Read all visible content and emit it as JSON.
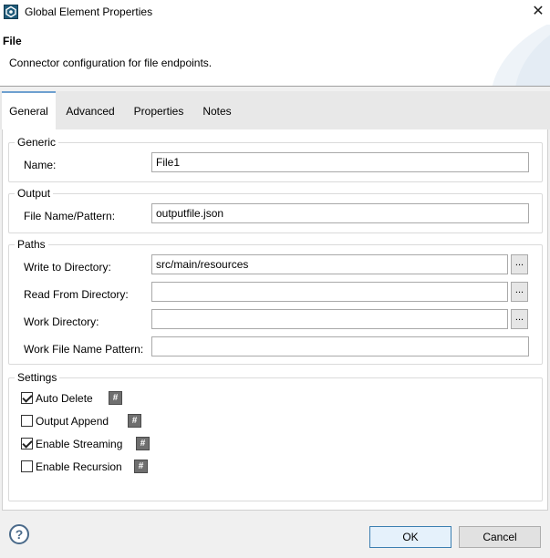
{
  "window": {
    "title": "Global Element Properties",
    "icon": "mule-config-icon",
    "close_glyph": "✕"
  },
  "header": {
    "title": "File",
    "description": "Connector configuration for file endpoints."
  },
  "tabs": [
    {
      "label": "General",
      "active": true
    },
    {
      "label": "Advanced",
      "active": false
    },
    {
      "label": "Properties",
      "active": false
    },
    {
      "label": "Notes",
      "active": false
    }
  ],
  "generic": {
    "title": "Generic",
    "name_label": "Name:",
    "name_value": "File1"
  },
  "output": {
    "title": "Output",
    "pattern_label": "File Name/Pattern:",
    "pattern_value": "outputfile.json"
  },
  "paths": {
    "title": "Paths",
    "write_label": "Write to Directory:",
    "write_value": "src/main/resources",
    "read_label": "Read From Directory:",
    "read_value": "",
    "work_label": "Work Directory:",
    "work_value": "",
    "work_pattern_label": "Work File Name Pattern:",
    "work_pattern_value": "",
    "browse_label": "..."
  },
  "settings": {
    "title": "Settings",
    "expr_glyph": "#",
    "items": [
      {
        "label": "Auto Delete",
        "checked": true
      },
      {
        "label": "Output Append",
        "checked": false
      },
      {
        "label": "Enable Streaming",
        "checked": true
      },
      {
        "label": "Enable Recursion",
        "checked": false
      }
    ]
  },
  "footer": {
    "help_glyph": "?",
    "ok_label": "OK",
    "cancel_label": "Cancel"
  },
  "colors": {
    "accent": "#6ea0d0",
    "ok_border": "#3c7fb1"
  }
}
